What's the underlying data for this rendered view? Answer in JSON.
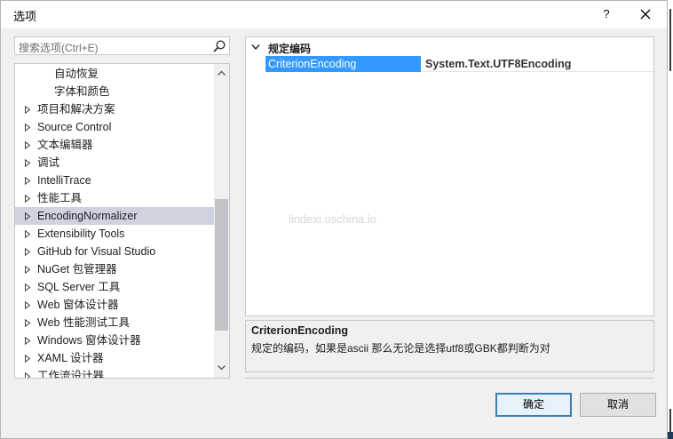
{
  "window": {
    "title": "选项",
    "help_label": "?"
  },
  "search": {
    "placeholder": "搜索选项(Ctrl+E)"
  },
  "tree": {
    "items": [
      {
        "label": "自动恢复",
        "indent": 2,
        "expandable": false,
        "selected": false
      },
      {
        "label": "字体和颜色",
        "indent": 2,
        "expandable": false,
        "selected": false
      },
      {
        "label": "项目和解决方案",
        "indent": 1,
        "expandable": true,
        "selected": false
      },
      {
        "label": "Source Control",
        "indent": 1,
        "expandable": true,
        "selected": false
      },
      {
        "label": "文本编辑器",
        "indent": 1,
        "expandable": true,
        "selected": false
      },
      {
        "label": "调试",
        "indent": 1,
        "expandable": true,
        "selected": false
      },
      {
        "label": "IntelliTrace",
        "indent": 1,
        "expandable": true,
        "selected": false
      },
      {
        "label": "性能工具",
        "indent": 1,
        "expandable": true,
        "selected": false
      },
      {
        "label": "EncodingNormalizer",
        "indent": 1,
        "expandable": true,
        "selected": true
      },
      {
        "label": "Extensibility Tools",
        "indent": 1,
        "expandable": true,
        "selected": false
      },
      {
        "label": "GitHub for Visual Studio",
        "indent": 1,
        "expandable": true,
        "selected": false
      },
      {
        "label": "NuGet 包管理器",
        "indent": 1,
        "expandable": true,
        "selected": false
      },
      {
        "label": "SQL Server 工具",
        "indent": 1,
        "expandable": true,
        "selected": false
      },
      {
        "label": "Web 窗体设计器",
        "indent": 1,
        "expandable": true,
        "selected": false
      },
      {
        "label": "Web 性能测试工具",
        "indent": 1,
        "expandable": true,
        "selected": false
      },
      {
        "label": "Windows 窗体设计器",
        "indent": 1,
        "expandable": true,
        "selected": false
      },
      {
        "label": "XAML 设计器",
        "indent": 1,
        "expandable": true,
        "selected": false
      },
      {
        "label": "工作流设计器",
        "indent": 1,
        "expandable": true,
        "selected": false
      }
    ]
  },
  "property_grid": {
    "category": "规定编码",
    "property_name": "CriterionEncoding",
    "property_value": "System.Text.UTF8Encoding",
    "watermark": "lindexi.oschina.io"
  },
  "description": {
    "title": "CriterionEncoding",
    "text": "规定的编码，如果是ascii 那么无论是选择utf8或GBK都判断为对"
  },
  "buttons": {
    "ok": "确定",
    "cancel": "取消"
  },
  "colors": {
    "selection": "#3399ff",
    "tree_selection": "#cfd3e0",
    "ok_border": "#3c7fb1"
  }
}
